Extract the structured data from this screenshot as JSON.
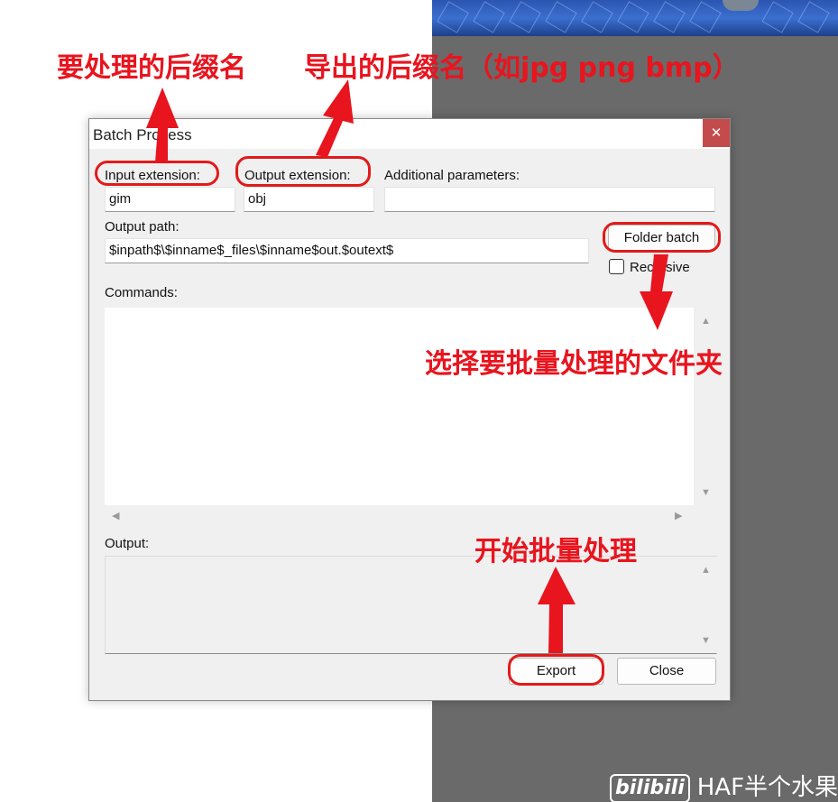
{
  "window": {
    "title": "Batch Process",
    "close_glyph": "✕"
  },
  "fields": {
    "input_extension": {
      "label": "Input extension:",
      "value": "gim"
    },
    "output_extension": {
      "label": "Output extension:",
      "value": "obj"
    },
    "additional_parameters": {
      "label": "Additional parameters:",
      "value": ""
    },
    "output_path": {
      "label": "Output path:",
      "value": "$inpath$\\$inname$_files\\$inname$out.$outext$"
    }
  },
  "folder_batch_label": "Folder batch",
  "recursive": {
    "label": "Recursive",
    "checked": false
  },
  "commands": {
    "label": "Commands:",
    "value": ""
  },
  "output": {
    "label": "Output:",
    "value": ""
  },
  "buttons": {
    "export": "Export",
    "close": "Close"
  },
  "annotations": {
    "input_ext": "要处理的后缀名",
    "output_ext": "导出的后缀名（如jpg png bmp）",
    "folder": "选择要批量处理的文件夹",
    "export": "开始批量处理",
    "color": "#e8141e"
  },
  "watermark": {
    "logo": "bilibili",
    "text": "HAF半个水果"
  }
}
